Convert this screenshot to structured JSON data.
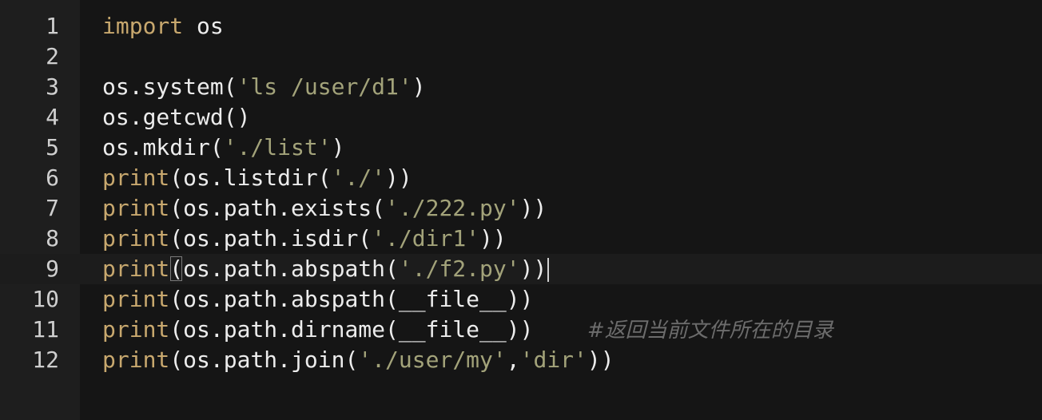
{
  "editor": {
    "language": "python",
    "active_line": 9,
    "lines": [
      {
        "number": "1",
        "tokens": [
          {
            "t": "keyword",
            "v": "import"
          },
          {
            "t": "plain",
            "v": " os"
          }
        ]
      },
      {
        "number": "2",
        "tokens": []
      },
      {
        "number": "3",
        "tokens": [
          {
            "t": "plain",
            "v": "os.system("
          },
          {
            "t": "string",
            "v": "'ls /user/d1'"
          },
          {
            "t": "plain",
            "v": ")"
          }
        ]
      },
      {
        "number": "4",
        "tokens": [
          {
            "t": "plain",
            "v": "os.getcwd()"
          }
        ]
      },
      {
        "number": "5",
        "tokens": [
          {
            "t": "plain",
            "v": "os.mkdir("
          },
          {
            "t": "string",
            "v": "'./list'"
          },
          {
            "t": "plain",
            "v": ")"
          }
        ]
      },
      {
        "number": "6",
        "tokens": [
          {
            "t": "builtin",
            "v": "print"
          },
          {
            "t": "plain",
            "v": "(os.listdir("
          },
          {
            "t": "string",
            "v": "'./'"
          },
          {
            "t": "plain",
            "v": "))"
          }
        ]
      },
      {
        "number": "7",
        "tokens": [
          {
            "t": "builtin",
            "v": "print"
          },
          {
            "t": "plain",
            "v": "(os.path.exists("
          },
          {
            "t": "string",
            "v": "'./222.py'"
          },
          {
            "t": "plain",
            "v": "))"
          }
        ]
      },
      {
        "number": "8",
        "tokens": [
          {
            "t": "builtin",
            "v": "print"
          },
          {
            "t": "plain",
            "v": "(os.path.isdir("
          },
          {
            "t": "string",
            "v": "'./dir1'"
          },
          {
            "t": "plain",
            "v": "))"
          }
        ]
      },
      {
        "number": "9",
        "tokens": [
          {
            "t": "builtin",
            "v": "print"
          },
          {
            "t": "plain",
            "v": "(",
            "match": true
          },
          {
            "t": "plain",
            "v": "os.path.abspath("
          },
          {
            "t": "string",
            "v": "'./f2.py'"
          },
          {
            "t": "plain",
            "v": "))"
          },
          {
            "t": "cursor",
            "v": ""
          }
        ]
      },
      {
        "number": "10",
        "tokens": [
          {
            "t": "builtin",
            "v": "print"
          },
          {
            "t": "plain",
            "v": "(os.path.abspath(__file__))"
          }
        ]
      },
      {
        "number": "11",
        "tokens": [
          {
            "t": "builtin",
            "v": "print"
          },
          {
            "t": "plain",
            "v": "(os.path.dirname(__file__))    "
          },
          {
            "t": "comment",
            "v": "#返回当前文件所在的目录"
          }
        ]
      },
      {
        "number": "12",
        "tokens": [
          {
            "t": "builtin",
            "v": "print"
          },
          {
            "t": "plain",
            "v": "(os.path.join("
          },
          {
            "t": "string",
            "v": "'./user/my'"
          },
          {
            "t": "plain",
            "v": ","
          },
          {
            "t": "string",
            "v": "'dir'"
          },
          {
            "t": "plain",
            "v": "))"
          }
        ]
      }
    ]
  },
  "colors": {
    "background": "#151515",
    "gutter": "#1e1e1e",
    "keyword": "#c8a86e",
    "string": "#a3a37a",
    "comment": "#6c6c6c",
    "text": "#ececec"
  }
}
